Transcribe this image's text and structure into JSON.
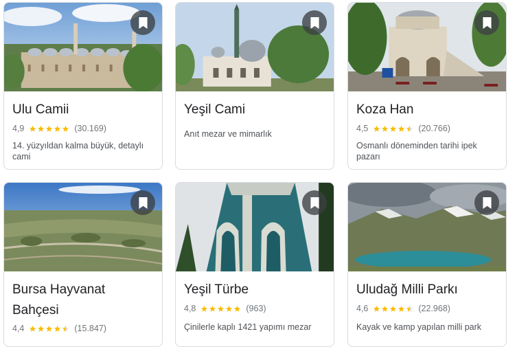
{
  "colors": {
    "star": "#fbbc04",
    "title": "#202124",
    "meta": "#70757a",
    "border": "#dadce0"
  },
  "places": [
    {
      "name": "Ulu Camii",
      "rating": "4,9",
      "stars": 4.9,
      "reviews": "(30.169)",
      "description": "14. yüzyıldan kalma büyük, detaylı cami",
      "save_icon": "bookmark-icon"
    },
    {
      "name": "Yeşil Cami",
      "description": "Anıt mezar ve mimarlık",
      "save_icon": "bookmark-icon"
    },
    {
      "name": "Koza Han",
      "rating": "4,5",
      "stars": 4.5,
      "reviews": "(20.766)",
      "description": "Osmanlı döneminden tarihi ipek pazarı",
      "save_icon": "bookmark-icon"
    },
    {
      "name": "Bursa Hayvanat Bahçesi",
      "rating": "4,4",
      "stars": 4.4,
      "reviews": "(15.847)",
      "save_icon": "bookmark-icon"
    },
    {
      "name": "Yeşil Türbe",
      "rating": "4,8",
      "stars": 4.8,
      "reviews": "(963)",
      "description": "Çinilerle kaplı 1421 yapımı mezar",
      "save_icon": "bookmark-icon"
    },
    {
      "name": "Uludağ Milli Parkı",
      "rating": "4,6",
      "stars": 4.6,
      "reviews": "(22.968)",
      "description": "Kayak ve kamp yapılan milli park",
      "save_icon": "bookmark-icon"
    }
  ]
}
